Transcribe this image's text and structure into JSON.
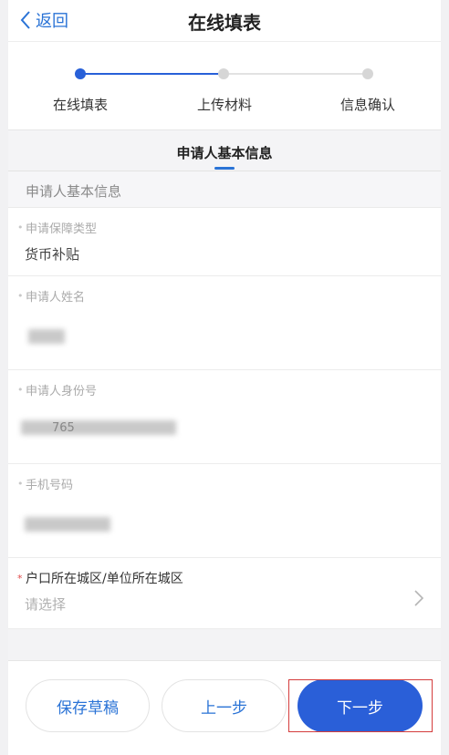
{
  "header": {
    "back_label": "返回",
    "title": "在线填表"
  },
  "steps": [
    {
      "label": "在线填表",
      "state": "active"
    },
    {
      "label": "上传材料",
      "state": "idle"
    },
    {
      "label": "信息确认",
      "state": "idle"
    }
  ],
  "tab": {
    "label": "申请人基本信息"
  },
  "section": {
    "title": "申请人基本信息"
  },
  "fields": {
    "type": {
      "label": "申请保障类型",
      "value": "货币补贴"
    },
    "name": {
      "label": "申请人姓名"
    },
    "id": {
      "label": "申请人身份号",
      "partial_value": "765"
    },
    "phone": {
      "label": "手机号码"
    },
    "district": {
      "label": "户口所在城区/单位所在城区",
      "placeholder": "请选择"
    }
  },
  "buttons": {
    "save_draft": "保存草稿",
    "prev": "上一步",
    "next": "下一步"
  },
  "colors": {
    "accent": "#2a5fd8",
    "link": "#2a73d6",
    "required": "#e04848",
    "highlight_box": "#d43c3c"
  }
}
